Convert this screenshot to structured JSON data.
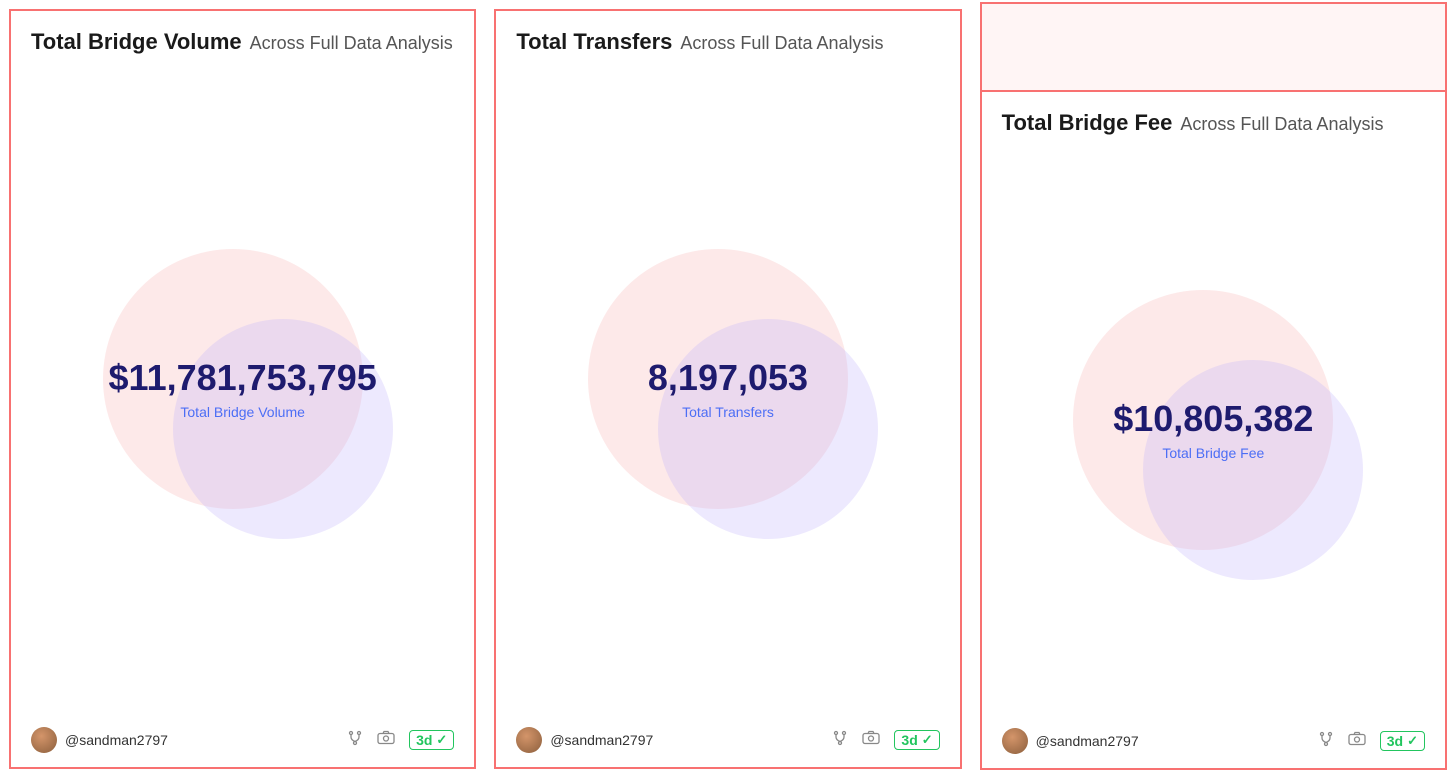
{
  "cards": [
    {
      "id": "bridge-volume",
      "title_bold": "Total Bridge Volume",
      "title_sub": "Across Full Data Analysis",
      "value": "$11,781,753,795",
      "label": "Total Bridge Volume",
      "username": "@sandman2797",
      "badge": "3d",
      "footer_icons": [
        "fork-icon",
        "camera-icon"
      ]
    },
    {
      "id": "total-transfers",
      "title_bold": "Total Transfers",
      "title_sub": "Across Full Data Analysis",
      "value": "8,197,053",
      "label": "Total Transfers",
      "username": "@sandman2797",
      "badge": "3d",
      "footer_icons": [
        "fork-icon",
        "camera-icon"
      ]
    },
    {
      "id": "bridge-fee",
      "title_bold": "Total Bridge Fee",
      "title_sub": "Across Full Data Analysis",
      "value": "$10,805,382",
      "label": "Total Bridge Fee",
      "username": "@sandman2797",
      "badge": "3d",
      "footer_icons": [
        "fork-icon",
        "camera-icon"
      ]
    }
  ],
  "partial_top_bg": "#fff5f5",
  "icons": {
    "fork": "⑃",
    "camera": "📷",
    "check": "✓"
  },
  "colors": {
    "accent_red": "#f87171",
    "value_color": "#1e1b6e",
    "label_color": "#4c6ef5",
    "badge_color": "#22c55e"
  }
}
